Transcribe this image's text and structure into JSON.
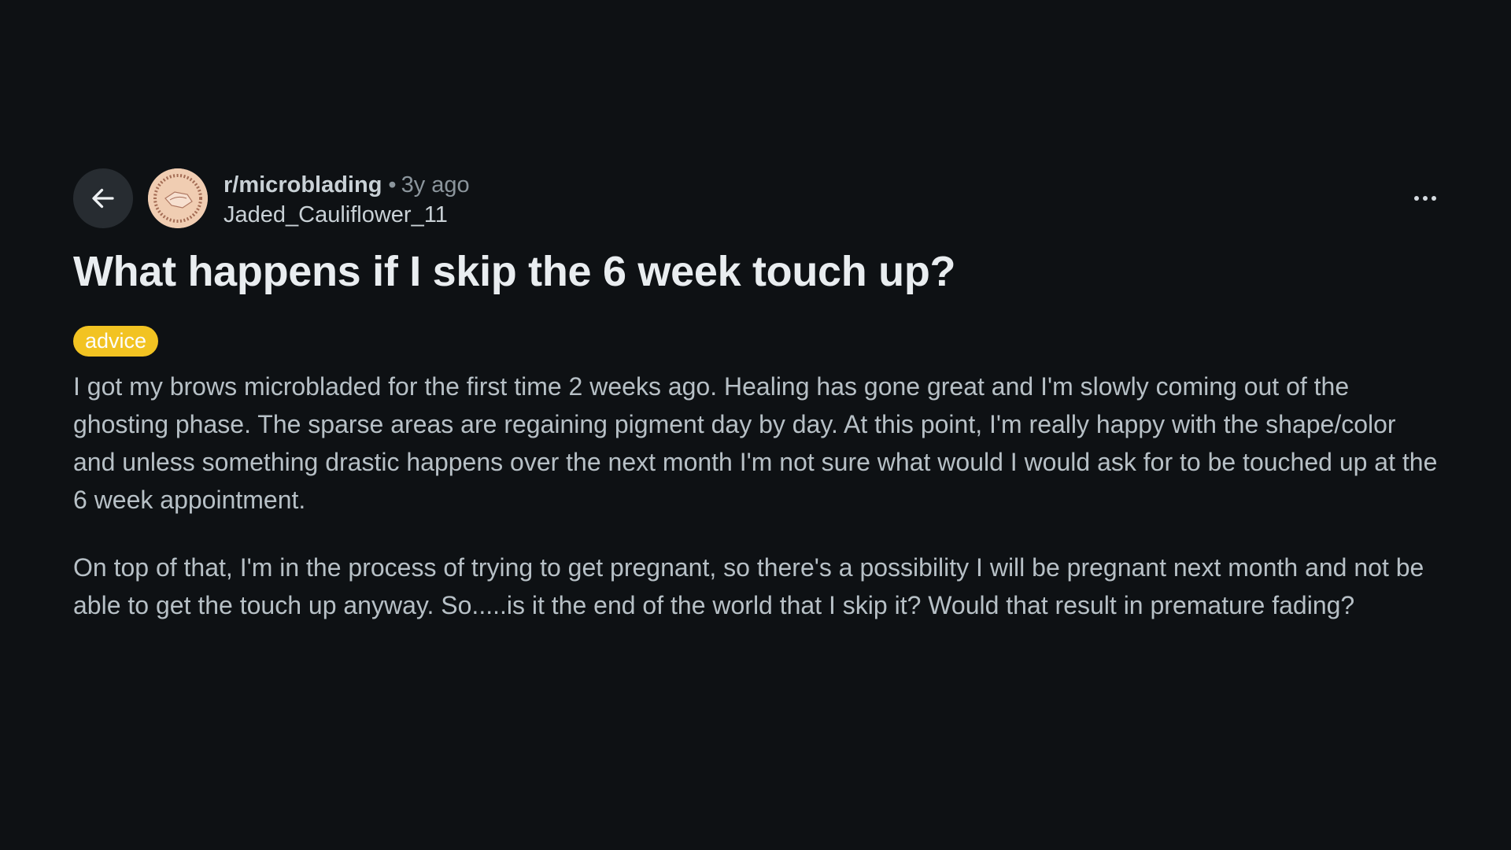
{
  "post": {
    "subreddit": "r/microblading",
    "separator": "•",
    "time_ago": "3y ago",
    "author": "Jaded_Cauliflower_11",
    "title": "What happens if I skip the 6 week touch up?",
    "flair": "advice",
    "body": [
      "I got my brows microbladed for the first time 2 weeks ago. Healing has gone great and I'm slowly coming out of the ghosting phase. The sparse areas are regaining pigment day by day. At this point, I'm really happy with the shape/color and unless something drastic happens over the next month I'm not sure what would I would ask for to be touched up at the 6 week appointment.",
      "On top of that, I'm in the process of trying to get pregnant, so there's a possibility I will be pregnant next month and not be able to get the touch up anyway. So.....is it the end of the world that I skip it? Would that result in premature fading?"
    ]
  },
  "icons": {
    "back": "arrow-left-icon",
    "avatar": "subreddit-avatar",
    "more": "more-horizontal-icon"
  },
  "colors": {
    "background": "#0e1114",
    "flair_bg": "#f2c322",
    "avatar_bg": "#f0cdb2",
    "title": "#e9edf0",
    "body": "#b7c0c6"
  }
}
